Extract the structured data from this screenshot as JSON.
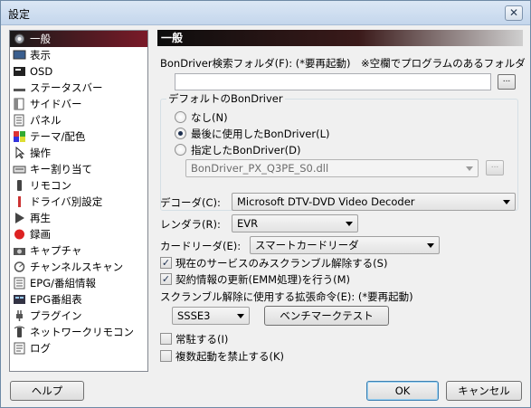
{
  "window": {
    "title": "設定",
    "close_glyph": "✕"
  },
  "sidebar": {
    "items": [
      {
        "label": "一般",
        "icon": "gear-icon",
        "selected": true
      },
      {
        "label": "表示",
        "icon": "monitor-icon"
      },
      {
        "label": "OSD",
        "icon": "osd-icon"
      },
      {
        "label": "ステータスバー",
        "icon": "statusbar-icon"
      },
      {
        "label": "サイドバー",
        "icon": "sidebar-panel-icon"
      },
      {
        "label": "パネル",
        "icon": "panel-icon"
      },
      {
        "label": "テーマ/配色",
        "icon": "palette-icon"
      },
      {
        "label": "操作",
        "icon": "cursor-icon"
      },
      {
        "label": "キー割り当て",
        "icon": "keyboard-icon"
      },
      {
        "label": "リモコン",
        "icon": "remote-icon"
      },
      {
        "label": "ドライバ別設定",
        "icon": "driver-icon"
      },
      {
        "label": "再生",
        "icon": "play-icon"
      },
      {
        "label": "録画",
        "icon": "record-icon"
      },
      {
        "label": "キャプチャ",
        "icon": "camera-icon"
      },
      {
        "label": "チャンネルスキャン",
        "icon": "scan-icon"
      },
      {
        "label": "EPG/番組情報",
        "icon": "epg-icon"
      },
      {
        "label": "EPG番組表",
        "icon": "epg-table-icon"
      },
      {
        "label": "プラグイン",
        "icon": "plug-icon"
      },
      {
        "label": "ネットワークリモコン",
        "icon": "network-remote-icon"
      },
      {
        "label": "ログ",
        "icon": "log-icon"
      }
    ]
  },
  "general": {
    "header": "一般",
    "bondriver_folder_label": "BonDriver検索フォルダ(F): (*要再起動)　※空欄でプログラムのあるフォルダ",
    "bondriver_folder_value": "",
    "browse_label": "...",
    "default_bondriver": {
      "title": "デフォルトのBonDriver",
      "options": [
        {
          "label": "なし(N)",
          "checked": false
        },
        {
          "label": "最後に使用したBonDriver(L)",
          "checked": true
        },
        {
          "label": "指定したBonDriver(D)",
          "checked": false
        }
      ],
      "specified_value": "BonDriver_PX_Q3PE_S0.dll",
      "browse_label": "..."
    },
    "decoder_label": "デコーダ(C):",
    "decoder_value": "Microsoft DTV-DVD Video Decoder",
    "renderer_label": "レンダラ(R):",
    "renderer_value": "EVR",
    "card_reader_label": "カードリーダ(E):",
    "card_reader_value": "スマートカードリーダ",
    "descramble_current_label": "現在のサービスのみスクランブル解除する(S)",
    "descramble_current_checked": true,
    "emm_label": "契約情報の更新(EMM処理)を行う(M)",
    "emm_checked": true,
    "instruction_label": "スクランブル解除に使用する拡張命令(E): (*要再起動)",
    "instruction_value": "SSSE3",
    "benchmark_label": "ベンチマークテスト",
    "resident_label": "常駐する(I)",
    "resident_checked": false,
    "no_multi_label": "複数起動を禁止する(K)",
    "no_multi_checked": false
  },
  "footer": {
    "help_label": "ヘルプ",
    "ok_label": "OK",
    "cancel_label": "キャンセル"
  },
  "colors": {
    "accent_header": "#3a1a1a",
    "selected_item": "#7a1a28"
  }
}
